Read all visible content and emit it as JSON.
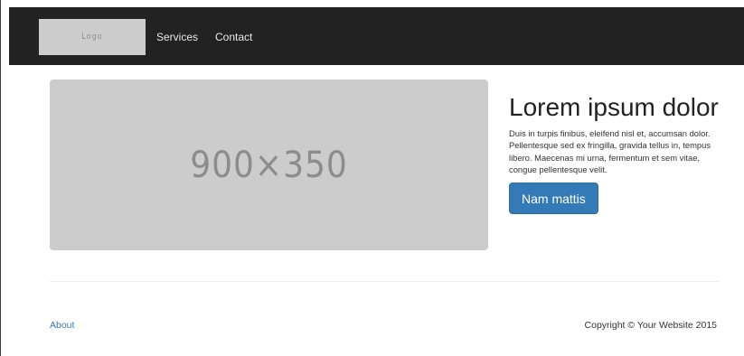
{
  "navbar": {
    "logo_text": "Logo",
    "links": [
      {
        "label": "Services"
      },
      {
        "label": "Contact"
      }
    ]
  },
  "hero": {
    "image_placeholder": "900×350",
    "title": "Lorem ipsum dolor",
    "body": "Duis in turpis finibus, eleifend nisl et, accumsan dolor. Pellentesque sed ex fringilla, gravida tellus in, tempus libero. Maecenas mi urna, fermentum et sem vitae, congue pellentesque velit.",
    "button_label": "Nam mattis"
  },
  "footer": {
    "link_label": "About",
    "copyright": "Copyright © Your Website 2015"
  },
  "colors": {
    "navbar_bg": "#222222",
    "placeholder_bg": "#cccccc",
    "primary": "#337ab7",
    "link": "#337ab7"
  }
}
